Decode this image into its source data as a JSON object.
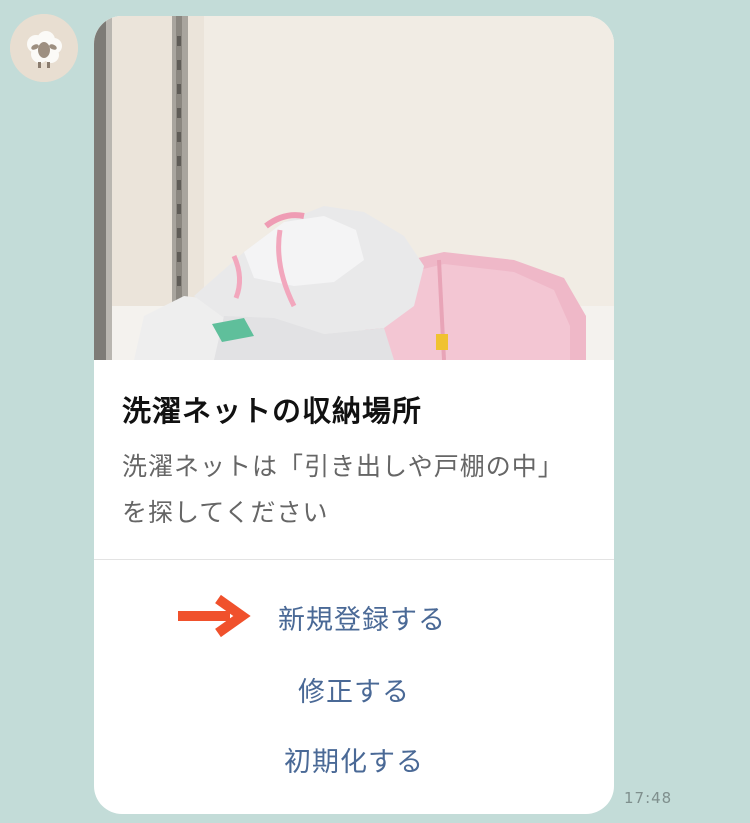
{
  "chat": {
    "avatar_icon": "sheep-avatar-icon",
    "timestamp": "17:48"
  },
  "card": {
    "image_icon": "laundry-nets-photo",
    "title": "洗濯ネットの収納場所",
    "description": "洗濯ネットは「引き出しや戸棚の中」を探してください",
    "actions": [
      {
        "label": "新規登録する"
      },
      {
        "label": "修正する"
      },
      {
        "label": "初期化する"
      }
    ]
  },
  "colors": {
    "background": "#c3dcd8",
    "action_text": "#4a6996",
    "arrow": "#f0512c"
  }
}
